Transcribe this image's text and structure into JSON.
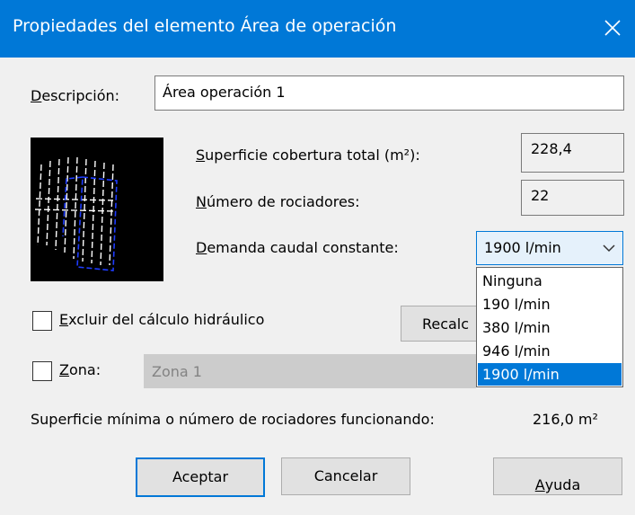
{
  "window": {
    "title": "Propiedades del elemento Área de operación",
    "close_icon": "close-icon"
  },
  "descripcion": {
    "label_first": "D",
    "label_rest": "escripción:",
    "value": "Área operación 1"
  },
  "superficie": {
    "label_first": "S",
    "label_rest": "uperficie cobertura total (m²):",
    "value": "228,4"
  },
  "rociadores": {
    "label_first": "N",
    "label_rest": "úmero de rociadores:",
    "value": "22"
  },
  "demanda": {
    "label_first": "D",
    "label_rest": "emanda caudal constante:",
    "selected": "1900 l/min",
    "options": [
      "Ninguna",
      "190 l/min",
      "380 l/min",
      "946 l/min",
      "1900 l/min"
    ]
  },
  "excluir": {
    "label_first": "E",
    "label_rest": "xcluir del cálculo hidráulico",
    "checked": false
  },
  "recalc_button": {
    "label_visible": "Recalc"
  },
  "zona": {
    "label_first": "Z",
    "label_rest": "ona:",
    "checked": false,
    "value": "Zona 1"
  },
  "summary": {
    "text": "Superficie mínima o número de rociadores funcionando:",
    "value": "216,0 m²"
  },
  "buttons": {
    "aceptar": "Aceptar",
    "cancelar": "Cancelar",
    "ayuda_first": "A",
    "ayuda_rest": "yuda"
  },
  "colors": {
    "titlebar": "#0078d7",
    "selection": "#0078d7",
    "preview_bg": "#000000",
    "preview_outline": "#1e3cff"
  }
}
